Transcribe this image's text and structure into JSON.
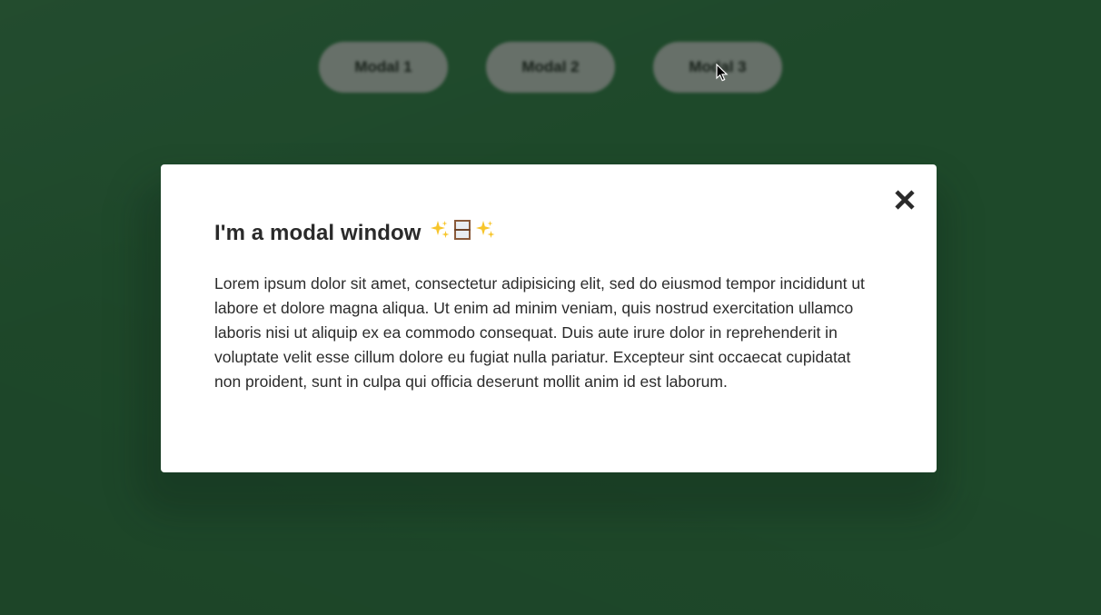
{
  "top_buttons": [
    {
      "label": "Modal 1"
    },
    {
      "label": "Modal 2"
    },
    {
      "label": "Modal 3"
    }
  ],
  "modal": {
    "title": "I'm a modal window",
    "title_icons": [
      "sparkles-icon",
      "window-icon",
      "sparkles-icon"
    ],
    "body": "Lorem ipsum dolor sit amet, consectetur adipisicing elit, sed do eiusmod tempor incididunt ut labore et dolore magna aliqua. Ut enim ad minim veniam, quis nostrud exercitation ullamco laboris nisi ut aliquip ex ea commodo consequat. Duis aute irure dolor in reprehenderit in voluptate velit esse cillum dolore eu fugiat nulla pariatur. Excepteur sint occaecat cupidatat non proident, sunt in culpa qui officia deserunt mollit anim id est laborum.",
    "close_icon": "close-icon"
  },
  "colors": {
    "background": "#2b6a3e",
    "overlay": "#11241677",
    "modal_bg": "#ffffff",
    "button_bg": "#b3b3b3",
    "text": "#2a2a2a"
  }
}
